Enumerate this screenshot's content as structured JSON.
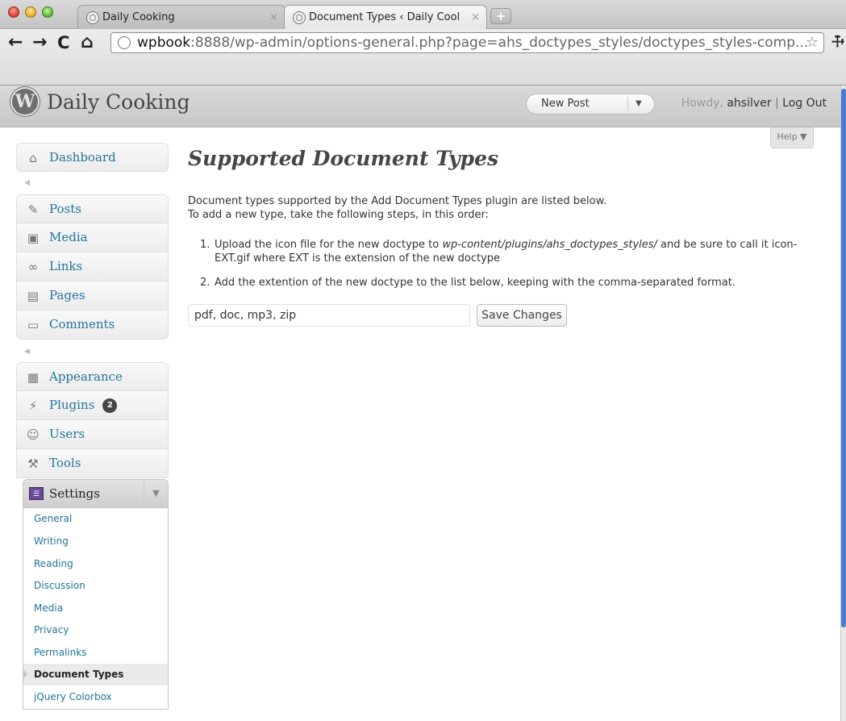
{
  "browser": {
    "tabs": [
      {
        "label": "Daily Cooking",
        "active": false
      },
      {
        "label": "Document Types ‹ Daily Cool",
        "active": true
      }
    ],
    "new_tab_symbol": "+",
    "close_symbol": "×",
    "url_host": "wpbook",
    "url_rest": ":8888/wp-admin/options-general.php?page=ahs_doctypes_styles/doctypes_styles-comp...",
    "icons": [
      "back-icon",
      "forward-icon",
      "reload-icon",
      "home-icon",
      "globe-icon",
      "star-icon",
      "wrench-icon"
    ]
  },
  "wp_header": {
    "logo": "W",
    "site_title": "Daily Cooking",
    "new_post_label": "New Post",
    "howdy_prefix": "Howdy, ",
    "username": "ahsilver",
    "separator": " | ",
    "logout_label": "Log Out"
  },
  "sidebar": {
    "items": [
      {
        "label": "Dashboard",
        "icon": "home-icon"
      },
      {
        "label": "Posts",
        "icon": "pin-icon"
      },
      {
        "label": "Media",
        "icon": "media-icon"
      },
      {
        "label": "Links",
        "icon": "link-icon"
      },
      {
        "label": "Pages",
        "icon": "pages-icon"
      },
      {
        "label": "Comments",
        "icon": "comment-icon"
      },
      {
        "label": "Appearance",
        "icon": "appearance-icon"
      },
      {
        "label": "Plugins",
        "icon": "plugin-icon",
        "badge": "2"
      },
      {
        "label": "Users",
        "icon": "users-icon"
      },
      {
        "label": "Tools",
        "icon": "tools-icon"
      }
    ],
    "settings": {
      "label": "Settings",
      "icon": "settings-icon",
      "submenu": [
        {
          "label": "General"
        },
        {
          "label": "Writing"
        },
        {
          "label": "Reading"
        },
        {
          "label": "Discussion"
        },
        {
          "label": "Media"
        },
        {
          "label": "Privacy"
        },
        {
          "label": "Permalinks"
        },
        {
          "label": "Document Types",
          "current": true
        },
        {
          "label": "jQuery Colorbox"
        }
      ]
    }
  },
  "main": {
    "help_label": "Help",
    "page_title": "Supported Document Types",
    "intro_line1": "Document types supported by the Add Document Types plugin are listed below.",
    "intro_line2": "To add a new type, take the following steps, in this order:",
    "steps": [
      {
        "num": "1.",
        "text_a": "Upload the icon file for the new doctype to ",
        "path": "wp-content/plugins/ahs_doctypes_styles/",
        "text_b": " and be sure to call it icon-EXT.gif where EXT is the extension of the new doctype"
      },
      {
        "num": "2.",
        "text_a": "Add the extention of the new doctype to the list below, keeping with the comma-separated format."
      }
    ],
    "doctypes_value": "pdf, doc, mp3, zip",
    "save_label": "Save Changes"
  },
  "colors": {
    "link": "#21759b",
    "header_bg": "#d9d9d9",
    "badge_bg": "#464646",
    "scroll_thumb": "#4a7bd0"
  }
}
